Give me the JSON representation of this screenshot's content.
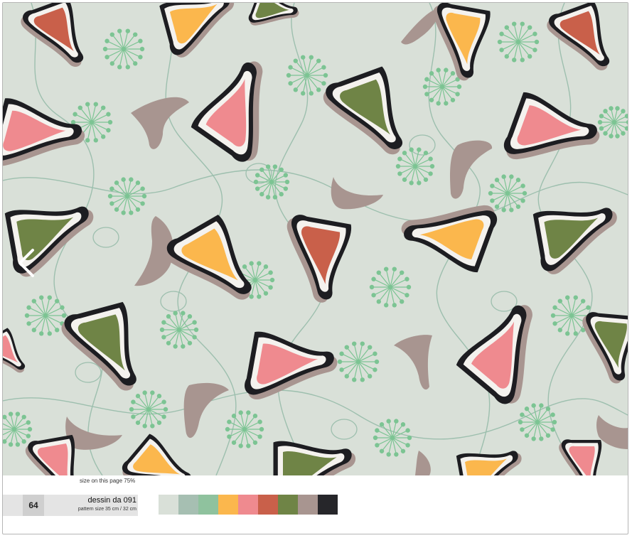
{
  "size_note": "size on this page 75%",
  "pattern_number": "64",
  "design_name": "dessin da 091",
  "pattern_size": "pattern size 35 cm / 32 cm",
  "palette": [
    "#d9e0d8",
    "#a6bfb2",
    "#8fc29e",
    "#fbb74d",
    "#ef8a8f",
    "#c9604a",
    "#6f8446",
    "#a89590",
    "#26262a"
  ],
  "colors": {
    "background": "#d9e0d8",
    "vine": "#9dbfae",
    "dandelion": "#7cc493",
    "ink": "#1d1d21",
    "taupe": "#a89590",
    "white": "#f4f2ee"
  },
  "icons": {
    "prev": "chevron-left-icon"
  }
}
